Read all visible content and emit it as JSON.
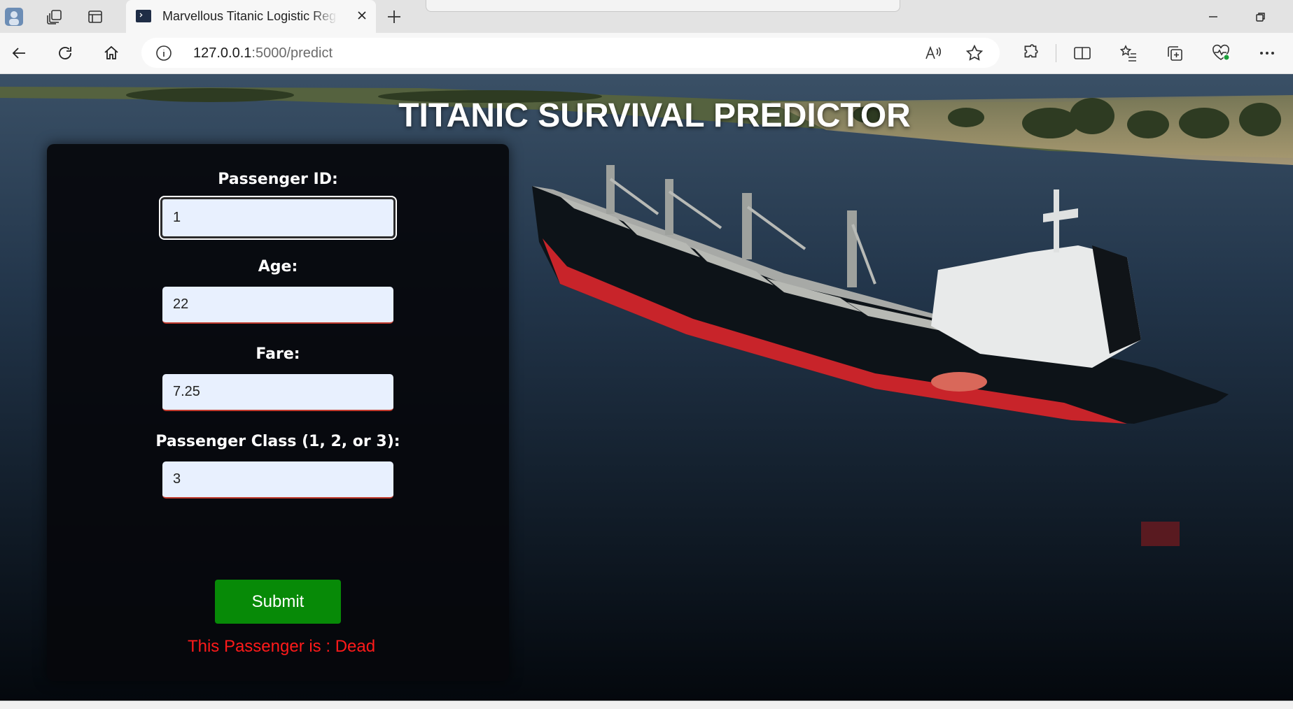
{
  "browser": {
    "tab_title": "Marvellous Titanic Logistic Regression",
    "url_host": "127.0.0.1",
    "url_path": ":5000/predict",
    "icons": {
      "profile": "profile-avatar-icon",
      "workspaces": "workspaces-icon",
      "tab_actions": "tab-actions-icon",
      "close_tab": "close-icon",
      "new_tab": "plus-icon",
      "back": "back-arrow-icon",
      "refresh": "refresh-icon",
      "home": "home-icon",
      "site_info": "info-icon",
      "read_aloud": "read-aloud-icon",
      "favorite": "star-icon",
      "extensions": "puzzle-icon",
      "split_screen": "split-screen-icon",
      "favorites": "favorites-list-icon",
      "collections": "collections-icon",
      "browser_essentials": "heart-pulse-icon",
      "more": "more-dots-icon"
    }
  },
  "page": {
    "title": "TITANIC SURVIVAL PREDICTOR",
    "form": {
      "passenger_id": {
        "label": "Passenger ID:",
        "value": "1"
      },
      "age": {
        "label": "Age:",
        "value": "22"
      },
      "fare": {
        "label": "Fare:",
        "value": "7.25"
      },
      "pclass": {
        "label": "Passenger Class (1, 2, or 3):",
        "value": "3"
      },
      "submit_label": "Submit"
    },
    "result": "This Passenger is : Dead"
  },
  "colors": {
    "submit_button": "#078a07",
    "result_text": "#ff1a1a",
    "input_background": "#e8f0fe",
    "panel_background": "#06080c"
  }
}
